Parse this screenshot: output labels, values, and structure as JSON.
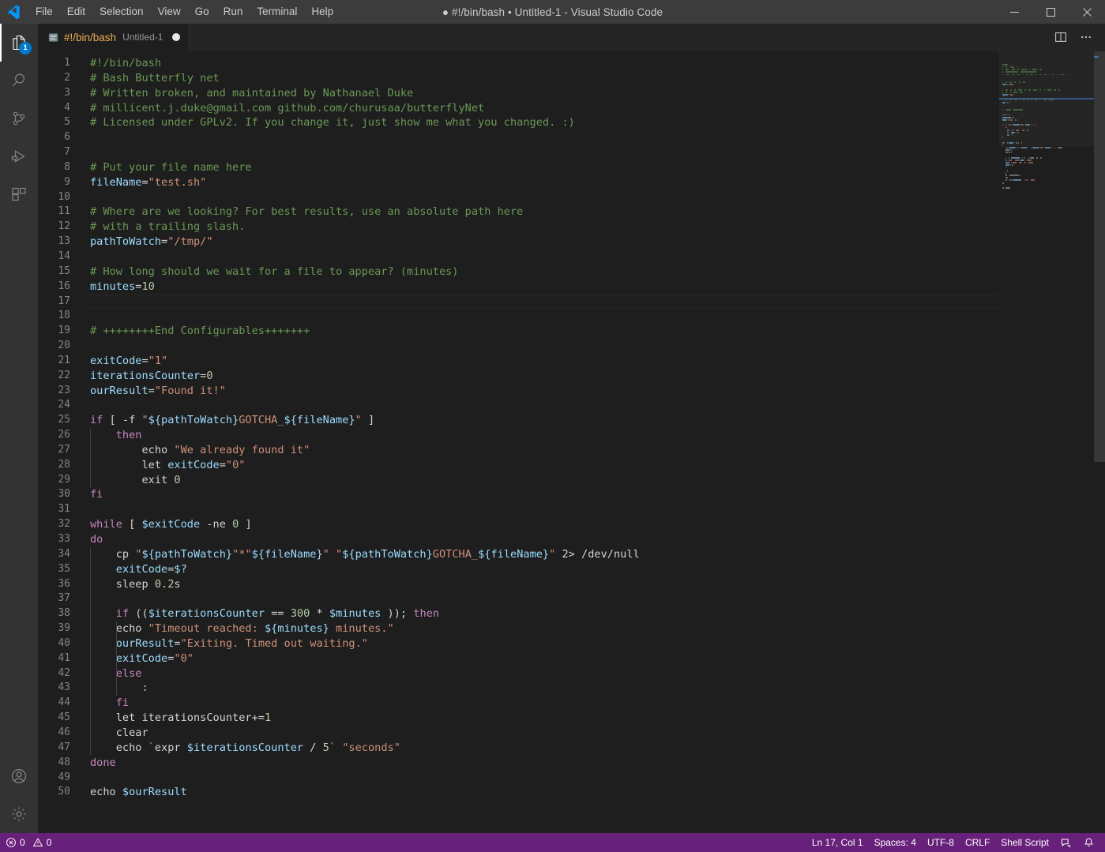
{
  "window": {
    "title": "● #!/bin/bash • Untitled-1 - Visual Studio Code",
    "minimize_label": "Minimize",
    "maximize_label": "Maximize",
    "close_label": "Close"
  },
  "menubar": {
    "items": [
      {
        "label": "File"
      },
      {
        "label": "Edit"
      },
      {
        "label": "Selection"
      },
      {
        "label": "View"
      },
      {
        "label": "Go"
      },
      {
        "label": "Run"
      },
      {
        "label": "Terminal"
      },
      {
        "label": "Help"
      }
    ]
  },
  "activitybar": {
    "items": [
      {
        "name": "explorer",
        "icon": "files-icon",
        "badge": "1",
        "active": true
      },
      {
        "name": "search",
        "icon": "search-icon",
        "badge": "",
        "active": false
      },
      {
        "name": "source-control",
        "icon": "source-control-icon",
        "badge": "",
        "active": false
      },
      {
        "name": "run-and-debug",
        "icon": "run-debug-icon",
        "badge": "",
        "active": false
      },
      {
        "name": "extensions",
        "icon": "extensions-icon",
        "badge": "",
        "active": false
      }
    ],
    "bottom": [
      {
        "name": "accounts",
        "icon": "account-icon"
      },
      {
        "name": "manage",
        "icon": "gear-icon"
      }
    ]
  },
  "tabs": {
    "active": {
      "icon": "shell-file-icon",
      "label": "#!/bin/bash",
      "description": "Untitled-1",
      "dirty": true
    },
    "actions": [
      {
        "name": "split-editor-right",
        "icon": "split-editor-icon"
      },
      {
        "name": "more-actions",
        "icon": "ellipsis-icon"
      }
    ]
  },
  "editor": {
    "language": "Shell Script",
    "current_line": 17,
    "total_lines": 50,
    "lines": [
      {
        "n": 1,
        "tokens": [
          {
            "t": "#!/bin/bash",
            "c": "cm"
          }
        ]
      },
      {
        "n": 2,
        "tokens": [
          {
            "t": "# Bash Butterfly net",
            "c": "cm"
          }
        ]
      },
      {
        "n": 3,
        "tokens": [
          {
            "t": "# Written broken, and maintained by Nathanael Duke",
            "c": "cm"
          }
        ]
      },
      {
        "n": 4,
        "tokens": [
          {
            "t": "# millicent.j.duke@gmail.com github.com/churusaa/butterflyNet",
            "c": "cm"
          }
        ]
      },
      {
        "n": 5,
        "tokens": [
          {
            "t": "# Licensed under GPLv2. If you change it, just show me what you changed. :)",
            "c": "cm"
          }
        ]
      },
      {
        "n": 6,
        "tokens": []
      },
      {
        "n": 7,
        "tokens": []
      },
      {
        "n": 8,
        "tokens": [
          {
            "t": "# Put your file name here",
            "c": "cm"
          }
        ]
      },
      {
        "n": 9,
        "tokens": [
          {
            "t": "fileName",
            "c": "va"
          },
          {
            "t": "=",
            "c": "pl"
          },
          {
            "t": "\"test.sh\"",
            "c": "st"
          }
        ]
      },
      {
        "n": 10,
        "tokens": []
      },
      {
        "n": 11,
        "tokens": [
          {
            "t": "# Where are we looking? For best results, use an absolute path here",
            "c": "cm"
          }
        ]
      },
      {
        "n": 12,
        "tokens": [
          {
            "t": "# with a trailing slash.",
            "c": "cm"
          }
        ]
      },
      {
        "n": 13,
        "tokens": [
          {
            "t": "pathToWatch",
            "c": "va"
          },
          {
            "t": "=",
            "c": "pl"
          },
          {
            "t": "\"/tmp/\"",
            "c": "st"
          }
        ]
      },
      {
        "n": 14,
        "tokens": []
      },
      {
        "n": 15,
        "tokens": [
          {
            "t": "# How long should we wait for a file to appear? (minutes)",
            "c": "cm"
          }
        ]
      },
      {
        "n": 16,
        "tokens": [
          {
            "t": "minutes",
            "c": "va"
          },
          {
            "t": "=",
            "c": "pl"
          },
          {
            "t": "10",
            "c": "nu"
          }
        ]
      },
      {
        "n": 17,
        "tokens": []
      },
      {
        "n": 18,
        "tokens": []
      },
      {
        "n": 19,
        "tokens": [
          {
            "t": "# ++++++++End Configurables+++++++",
            "c": "cm"
          }
        ]
      },
      {
        "n": 20,
        "tokens": []
      },
      {
        "n": 21,
        "tokens": [
          {
            "t": "exitCode",
            "c": "va"
          },
          {
            "t": "=",
            "c": "pl"
          },
          {
            "t": "\"1\"",
            "c": "st"
          }
        ]
      },
      {
        "n": 22,
        "tokens": [
          {
            "t": "iterationsCounter",
            "c": "va"
          },
          {
            "t": "=",
            "c": "pl"
          },
          {
            "t": "0",
            "c": "nu"
          }
        ]
      },
      {
        "n": 23,
        "tokens": [
          {
            "t": "ourResult",
            "c": "va"
          },
          {
            "t": "=",
            "c": "pl"
          },
          {
            "t": "\"Found it!\"",
            "c": "st"
          }
        ]
      },
      {
        "n": 24,
        "tokens": []
      },
      {
        "n": 25,
        "tokens": [
          {
            "t": "if",
            "c": "kw"
          },
          {
            "t": " [ -f ",
            "c": "pl"
          },
          {
            "t": "\"",
            "c": "st"
          },
          {
            "t": "${pathToWatch}",
            "c": "va"
          },
          {
            "t": "GOTCHA_",
            "c": "st"
          },
          {
            "t": "${fileName}",
            "c": "va"
          },
          {
            "t": "\"",
            "c": "st"
          },
          {
            "t": " ]",
            "c": "pl"
          }
        ]
      },
      {
        "n": 26,
        "tokens": [
          {
            "t": "    ",
            "c": "pl"
          },
          {
            "t": "then",
            "c": "kw"
          }
        ]
      },
      {
        "n": 27,
        "tokens": [
          {
            "t": "        ",
            "c": "pl"
          },
          {
            "t": "echo",
            "c": "pl"
          },
          {
            "t": " ",
            "c": "pl"
          },
          {
            "t": "\"We already found it\"",
            "c": "st"
          }
        ]
      },
      {
        "n": 28,
        "tokens": [
          {
            "t": "        ",
            "c": "pl"
          },
          {
            "t": "let",
            "c": "pl"
          },
          {
            "t": " ",
            "c": "pl"
          },
          {
            "t": "exitCode",
            "c": "va"
          },
          {
            "t": "=",
            "c": "pl"
          },
          {
            "t": "\"0\"",
            "c": "st"
          }
        ]
      },
      {
        "n": 29,
        "tokens": [
          {
            "t": "        ",
            "c": "pl"
          },
          {
            "t": "exit",
            "c": "pl"
          },
          {
            "t": " ",
            "c": "pl"
          },
          {
            "t": "0",
            "c": "nu"
          }
        ]
      },
      {
        "n": 30,
        "tokens": [
          {
            "t": "fi",
            "c": "kw"
          }
        ]
      },
      {
        "n": 31,
        "tokens": []
      },
      {
        "n": 32,
        "tokens": [
          {
            "t": "while",
            "c": "kw"
          },
          {
            "t": " [ ",
            "c": "pl"
          },
          {
            "t": "$exitCode",
            "c": "va"
          },
          {
            "t": " -ne ",
            "c": "pl"
          },
          {
            "t": "0",
            "c": "nu"
          },
          {
            "t": " ]",
            "c": "pl"
          }
        ]
      },
      {
        "n": 33,
        "tokens": [
          {
            "t": "do",
            "c": "kw"
          }
        ]
      },
      {
        "n": 34,
        "tokens": [
          {
            "t": "    cp ",
            "c": "pl"
          },
          {
            "t": "\"",
            "c": "st"
          },
          {
            "t": "${pathToWatch}",
            "c": "va"
          },
          {
            "t": "\"",
            "c": "st"
          },
          {
            "t": "*",
            "c": "st"
          },
          {
            "t": "\"",
            "c": "st"
          },
          {
            "t": "${fileName}",
            "c": "va"
          },
          {
            "t": "\"",
            "c": "st"
          },
          {
            "t": " ",
            "c": "pl"
          },
          {
            "t": "\"",
            "c": "st"
          },
          {
            "t": "${pathToWatch}",
            "c": "va"
          },
          {
            "t": "GOTCHA_",
            "c": "st"
          },
          {
            "t": "${fileName}",
            "c": "va"
          },
          {
            "t": "\"",
            "c": "st"
          },
          {
            "t": " 2> /dev/null",
            "c": "pl"
          }
        ]
      },
      {
        "n": 35,
        "tokens": [
          {
            "t": "    ",
            "c": "pl"
          },
          {
            "t": "exitCode",
            "c": "va"
          },
          {
            "t": "=",
            "c": "pl"
          },
          {
            "t": "$?",
            "c": "va"
          }
        ]
      },
      {
        "n": 36,
        "tokens": [
          {
            "t": "    sleep ",
            "c": "pl"
          },
          {
            "t": "0.2",
            "c": "nu"
          },
          {
            "t": "s",
            "c": "pl"
          }
        ]
      },
      {
        "n": 37,
        "tokens": []
      },
      {
        "n": 38,
        "tokens": [
          {
            "t": "    ",
            "c": "pl"
          },
          {
            "t": "if",
            "c": "kw"
          },
          {
            "t": " ((",
            "c": "pl"
          },
          {
            "t": "$iterationsCounter",
            "c": "va"
          },
          {
            "t": " == ",
            "c": "pl"
          },
          {
            "t": "300",
            "c": "nu"
          },
          {
            "t": " * ",
            "c": "pl"
          },
          {
            "t": "$minutes",
            "c": "va"
          },
          {
            "t": " ));",
            "c": "pl"
          },
          {
            "t": " ",
            "c": "pl"
          },
          {
            "t": "then",
            "c": "kw"
          }
        ]
      },
      {
        "n": 39,
        "tokens": [
          {
            "t": "    echo ",
            "c": "pl"
          },
          {
            "t": "\"Timeout reached: ",
            "c": "st"
          },
          {
            "t": "${minutes}",
            "c": "va"
          },
          {
            "t": " minutes.\"",
            "c": "st"
          }
        ]
      },
      {
        "n": 40,
        "tokens": [
          {
            "t": "    ",
            "c": "pl"
          },
          {
            "t": "ourResult",
            "c": "va"
          },
          {
            "t": "=",
            "c": "pl"
          },
          {
            "t": "\"Exiting. Timed out waiting.\"",
            "c": "st"
          }
        ]
      },
      {
        "n": 41,
        "tokens": [
          {
            "t": "    ",
            "c": "pl"
          },
          {
            "t": "exitCode",
            "c": "va"
          },
          {
            "t": "=",
            "c": "pl"
          },
          {
            "t": "\"0\"",
            "c": "st"
          }
        ]
      },
      {
        "n": 42,
        "tokens": [
          {
            "t": "    ",
            "c": "pl"
          },
          {
            "t": "else",
            "c": "kw"
          }
        ]
      },
      {
        "n": 43,
        "tokens": [
          {
            "t": "        ",
            "c": "pl"
          },
          {
            "t": ":",
            "c": "nu"
          }
        ]
      },
      {
        "n": 44,
        "tokens": [
          {
            "t": "    ",
            "c": "pl"
          },
          {
            "t": "fi",
            "c": "kw"
          }
        ]
      },
      {
        "n": 45,
        "tokens": [
          {
            "t": "    let iterationsCounter+=",
            "c": "pl"
          },
          {
            "t": "1",
            "c": "nu"
          }
        ]
      },
      {
        "n": 46,
        "tokens": [
          {
            "t": "    clear",
            "c": "pl"
          }
        ]
      },
      {
        "n": 47,
        "tokens": [
          {
            "t": "    echo ",
            "c": "pl"
          },
          {
            "t": "`",
            "c": "st"
          },
          {
            "t": "expr ",
            "c": "pl"
          },
          {
            "t": "$iterationsCounter",
            "c": "va"
          },
          {
            "t": " / ",
            "c": "pl"
          },
          {
            "t": "5",
            "c": "nu"
          },
          {
            "t": "`",
            "c": "st"
          },
          {
            "t": " ",
            "c": "pl"
          },
          {
            "t": "\"seconds\"",
            "c": "st"
          }
        ]
      },
      {
        "n": 48,
        "tokens": [
          {
            "t": "done",
            "c": "kw"
          }
        ]
      },
      {
        "n": 49,
        "tokens": []
      },
      {
        "n": 50,
        "tokens": [
          {
            "t": "echo ",
            "c": "pl"
          },
          {
            "t": "$ourResult",
            "c": "va"
          }
        ]
      }
    ]
  },
  "statusbar": {
    "errors": "0",
    "warnings": "0",
    "position": "Ln 17, Col 1",
    "indentation": "Spaces: 4",
    "encoding": "UTF-8",
    "eol": "CRLF",
    "language": "Shell Script",
    "feedback_icon": "feedback-icon",
    "notifications_icon": "bell-icon"
  },
  "colors": {
    "statusbar_bg": "#68217a",
    "accent": "#007acc",
    "comment": "#6a9955",
    "keyword": "#c586c0",
    "string": "#ce9178",
    "variable": "#9cdcfe",
    "editor_bg": "#1e1e1e",
    "activitybar_bg": "#333333",
    "titlebar_bg": "#3c3c3c"
  }
}
